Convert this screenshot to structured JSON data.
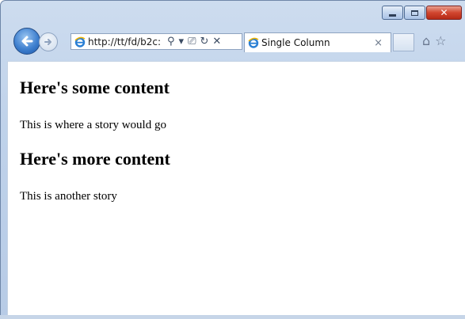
{
  "window": {
    "caption_buttons": {
      "close_symbol": "✕"
    }
  },
  "toolbar": {
    "address_url": "http://tt/fd/b2c:",
    "search_symbol": "⚲",
    "dropdown_symbol": "▾",
    "compat_symbol": "⎚",
    "refresh_symbol": "↻",
    "stop_symbol": "✕"
  },
  "tabs": [
    {
      "title": "Single Column",
      "close_symbol": "×"
    }
  ],
  "command_icons": {
    "home": "⌂",
    "favorites": "☆"
  },
  "page": {
    "sections": [
      {
        "heading": "Here's some content",
        "body": "This is where a story would go"
      },
      {
        "heading": "Here's more content",
        "body": "This is another story"
      }
    ]
  },
  "colors": {
    "frame": "#bfd2ea",
    "back_button": "#3f80cf",
    "close_button": "#d1462f"
  },
  "icons": {
    "back": "arrow-left-icon",
    "forward": "arrow-right-icon",
    "ie": "ie-logo-icon"
  }
}
